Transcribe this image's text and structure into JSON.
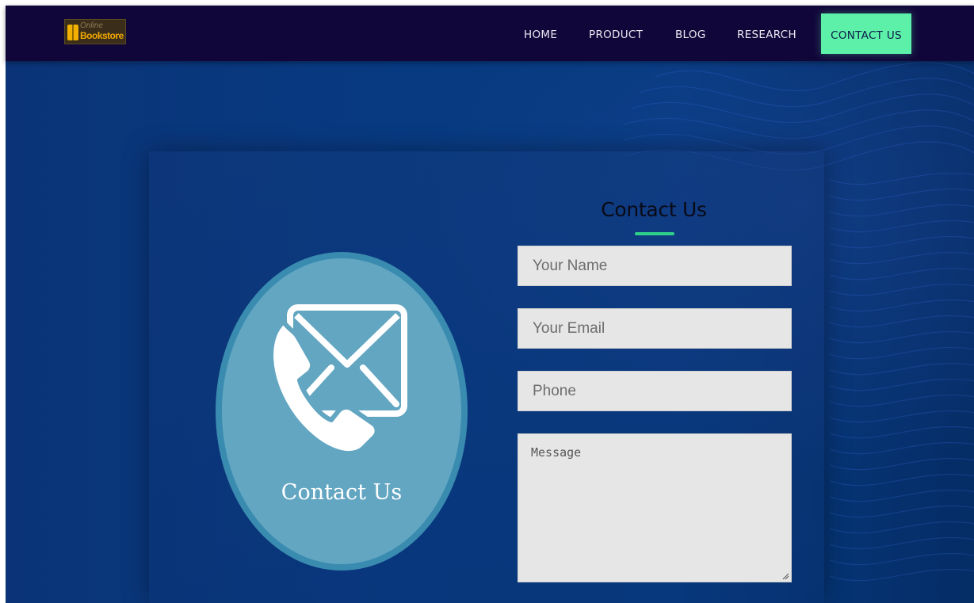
{
  "brand": {
    "logo_small": "Online",
    "logo_big": "Bookstore",
    "colors": {
      "nav_bg": "#11063a",
      "accent": "#5cf0a8",
      "page_bg": "#083a82"
    }
  },
  "nav": {
    "items": [
      {
        "label": "HOME"
      },
      {
        "label": "PRODUCT"
      },
      {
        "label": "BLOG"
      },
      {
        "label": "RESEARCH"
      },
      {
        "label": "CONTACT US",
        "active": true
      }
    ]
  },
  "hero": {
    "circle_label": "Contact Us",
    "icons": [
      "envelope-icon",
      "phone-icon"
    ]
  },
  "form": {
    "title": "Contact Us",
    "name_placeholder": "Your Name",
    "email_placeholder": "Your Email",
    "phone_placeholder": "Phone",
    "message_placeholder": "Message"
  }
}
